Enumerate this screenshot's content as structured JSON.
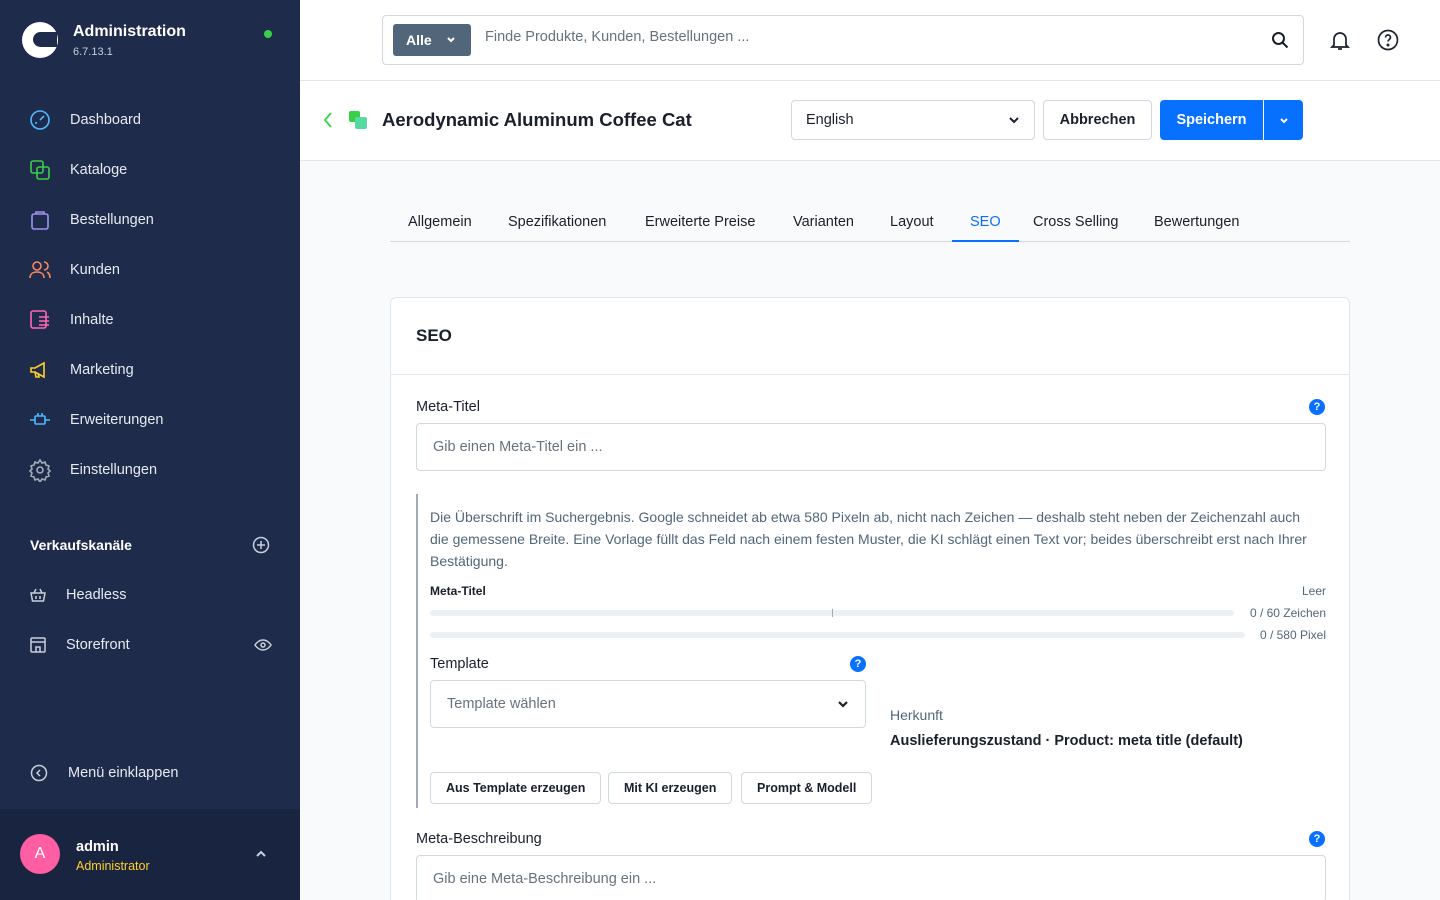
{
  "app": {
    "title": "Administration",
    "version": "6.7.13.1"
  },
  "sidebar": {
    "items": [
      {
        "label": "Dashboard",
        "icon": "dashboard-icon"
      },
      {
        "label": "Kataloge",
        "icon": "catalog-icon"
      },
      {
        "label": "Bestellungen",
        "icon": "shopping-bag-icon"
      },
      {
        "label": "Kunden",
        "icon": "users-icon"
      },
      {
        "label": "Inhalte",
        "icon": "content-icon"
      },
      {
        "label": "Marketing",
        "icon": "megaphone-icon"
      },
      {
        "label": "Erweiterungen",
        "icon": "plug-icon"
      },
      {
        "label": "Einstellungen",
        "icon": "gear-icon"
      }
    ],
    "sales_channels_title": "Verkaufskanäle",
    "sales_channels": [
      {
        "label": "Headless",
        "icon": "basket-icon"
      },
      {
        "label": "Storefront",
        "icon": "storefront-icon"
      }
    ],
    "collapse_label": "Menü einklappen",
    "user": {
      "initial": "A",
      "name": "admin",
      "role": "Administrator"
    }
  },
  "search": {
    "type_label": "Alle",
    "placeholder": "Finde Produkte, Kunden, Bestellungen ..."
  },
  "smartbar": {
    "title": "Aerodynamic Aluminum Coffee Cat",
    "language": "English",
    "cancel_label": "Abbrechen",
    "save_label": "Speichern"
  },
  "tabs": [
    "Allgemein",
    "Spezifikationen",
    "Erweiterte Preise",
    "Varianten",
    "Layout",
    "SEO",
    "Cross Selling",
    "Bewertungen"
  ],
  "active_tab": "SEO",
  "seo": {
    "card_title": "SEO",
    "meta_title_label": "Meta-Titel",
    "meta_title_placeholder": "Gib einen Meta-Titel ein ...",
    "help_glyph": "?",
    "description": "Die Überschrift im Suchergebnis. Google schneidet ab etwa 580 Pixeln ab, nicht nach Zeichen — deshalb steht neben der Zeichenzahl auch die gemessene Breite. Eine Vorlage füllt das Feld nach einem festen Muster, die KI schlägt einen Text vor; beides überschreibt erst nach Ihrer Bestätigung.",
    "meter_label": "Meta-Titel",
    "meter_status": "Leer",
    "char_count": "0 / 60 Zeichen",
    "pixel_count": "0 / 580 Pixel",
    "char_fill": 0,
    "pixel_fill": 0,
    "template_label": "Template",
    "template_placeholder": "Template wählen",
    "origin_label": "Herkunft",
    "origin_value": "Auslieferungszustand · Product: meta title (default)",
    "buttons": [
      "Aus Template erzeugen",
      "Mit KI erzeugen",
      "Prompt & Modell"
    ],
    "meta_description_label": "Meta-Beschreibung",
    "meta_description_placeholder": "Gib eine Meta-Beschreibung ein ..."
  },
  "colors": {
    "sidebar": "#1e2b4a",
    "accent": "#0870ff",
    "online": "#37d046",
    "avatar": "#ff5fa2",
    "role": "#ffd028"
  }
}
